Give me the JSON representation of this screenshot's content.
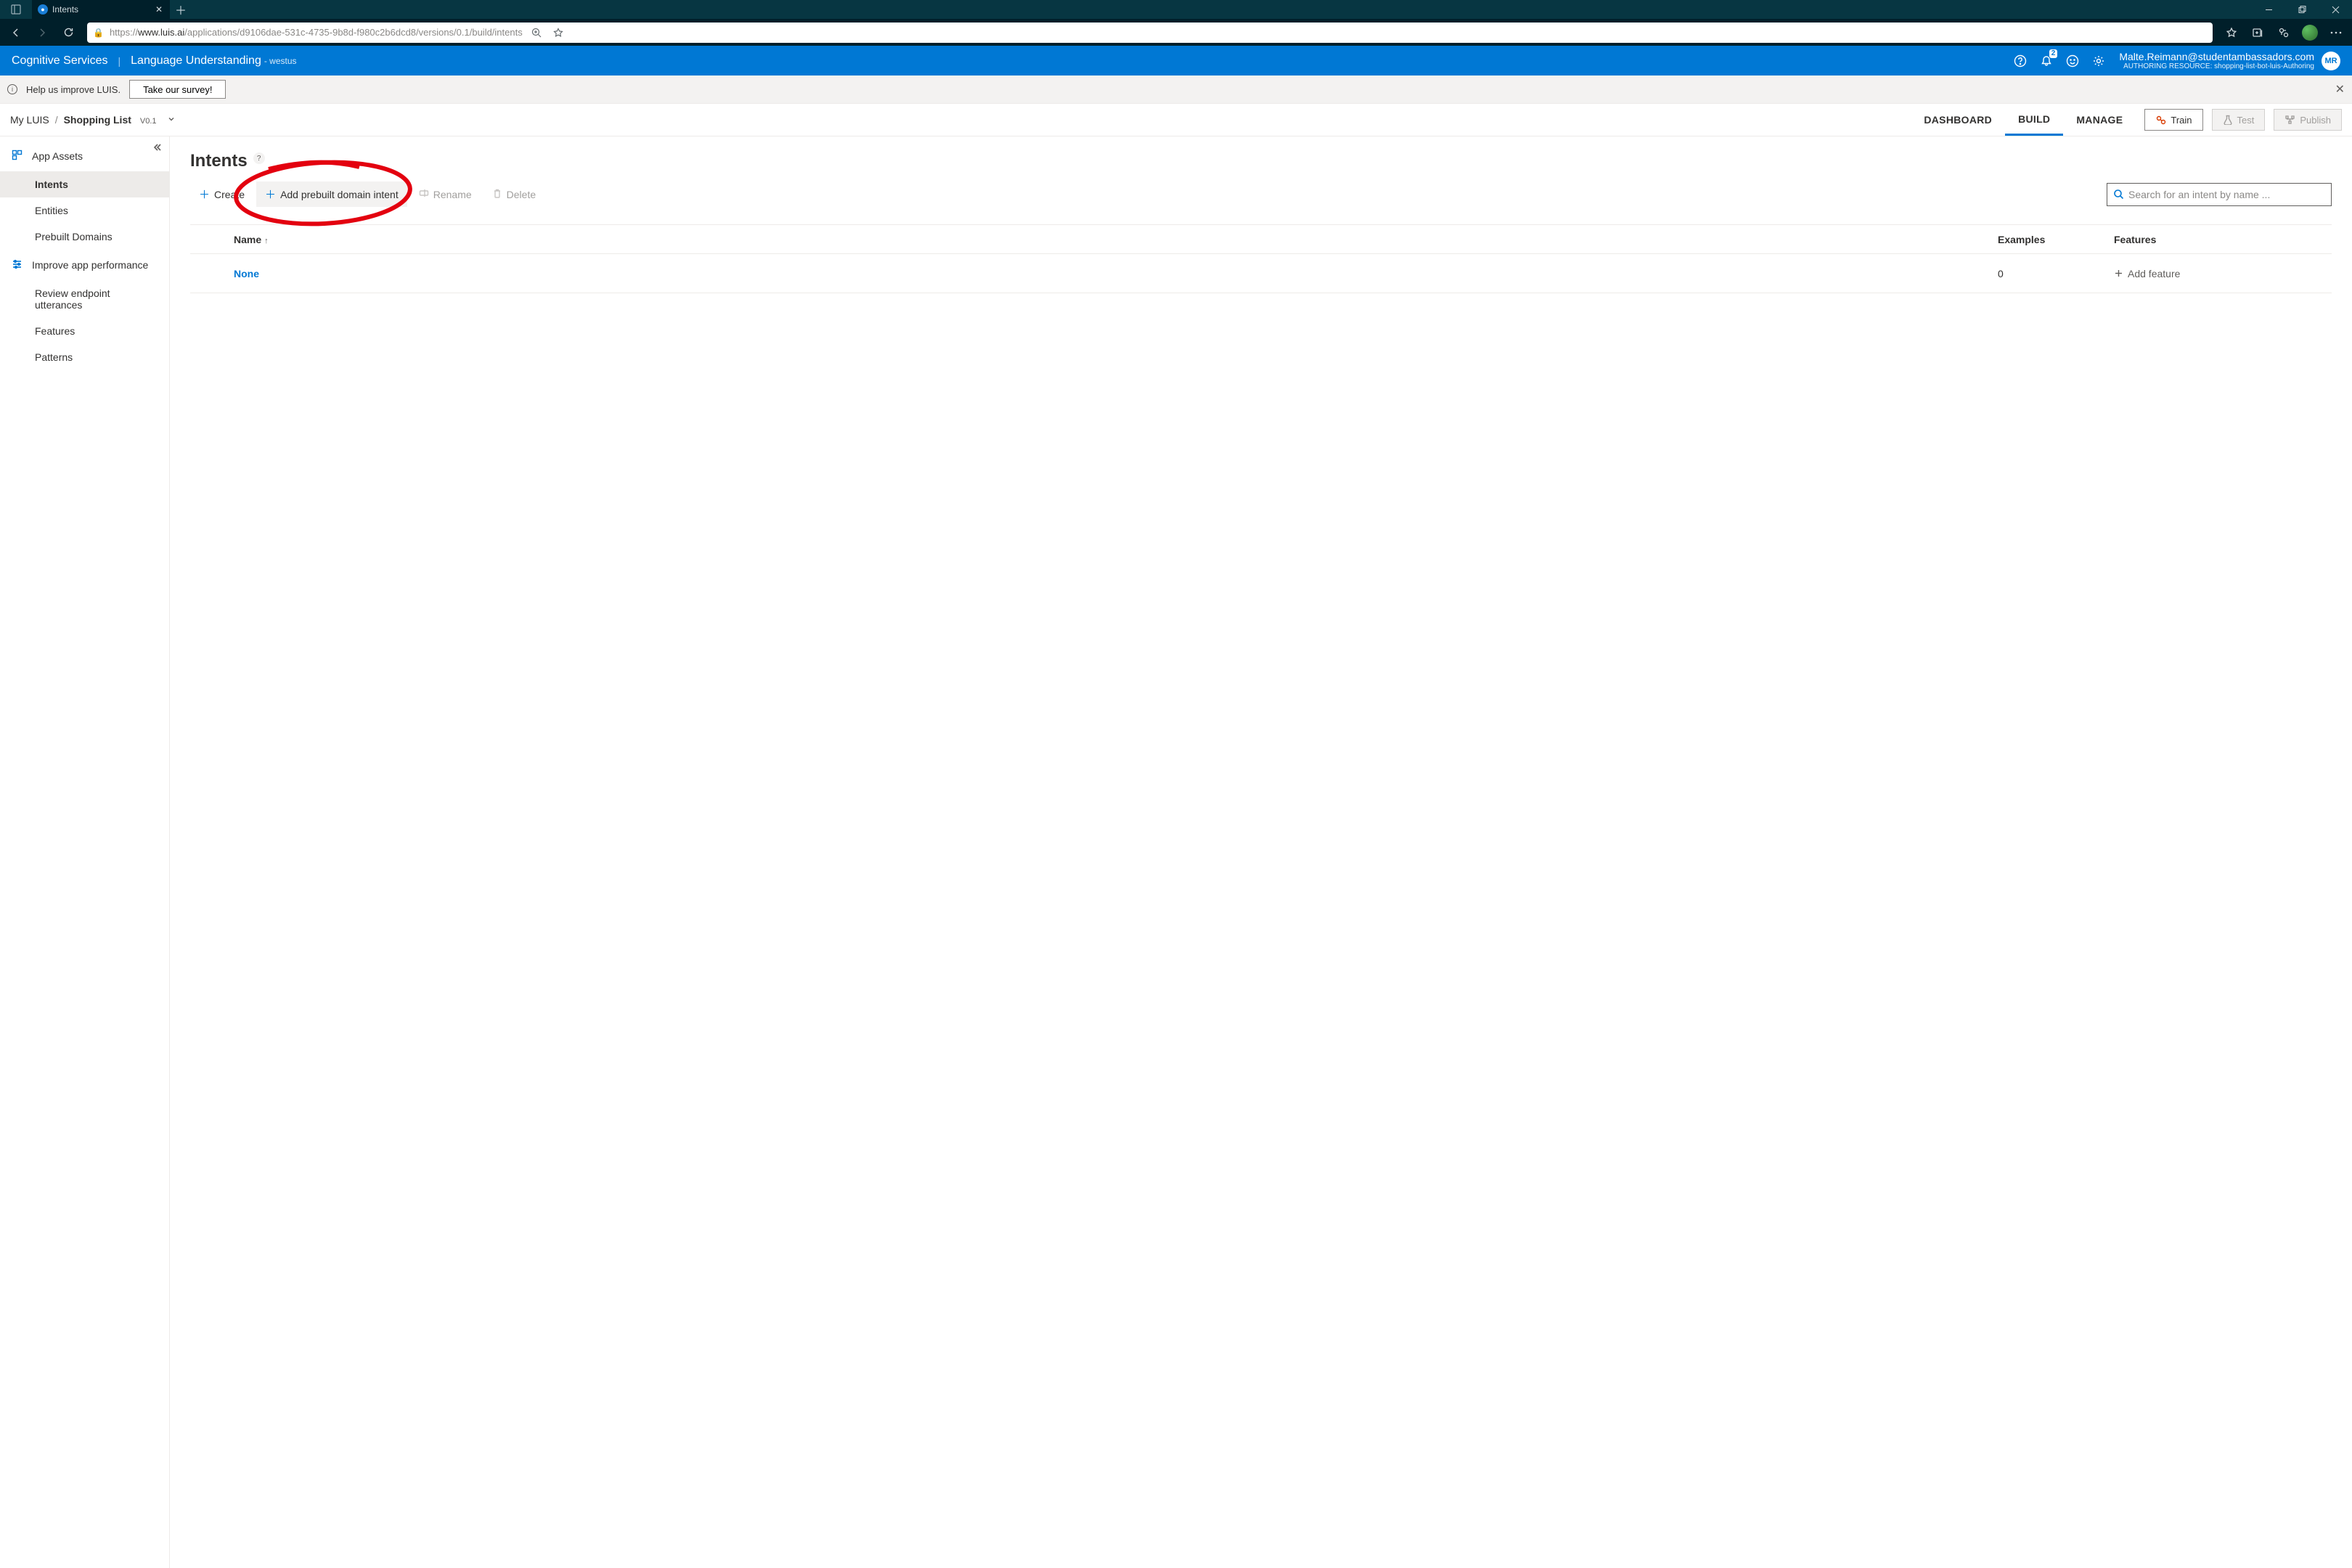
{
  "browser": {
    "tab_title": "Intents",
    "url_prefix": "https://",
    "url_host": "www.luis.ai",
    "url_path": "/applications/d9106dae-531c-4735-9b8d-f980c2b6dcd8/versions/0.1/build/intents"
  },
  "luis_header": {
    "service": "Cognitive Services",
    "product": "Language Understanding",
    "region": "- westus",
    "notification_count": "2",
    "user_email": "Malte.Reimann@studentambassadors.com",
    "resource_label": "AUTHORING RESOURCE:",
    "resource_name": "shopping-list-bot-luis-Authoring",
    "user_initials": "MR"
  },
  "banner": {
    "text": "Help us improve LUIS.",
    "button": "Take our survey!"
  },
  "breadcrumb": {
    "root": "My LUIS",
    "app": "Shopping List",
    "version": "V0.1"
  },
  "maintabs": {
    "dashboard": "DASHBOARD",
    "build": "BUILD",
    "manage": "MANAGE"
  },
  "actions": {
    "train": "Train",
    "test": "Test",
    "publish": "Publish"
  },
  "sidebar": {
    "group_assets": "App Assets",
    "intents": "Intents",
    "entities": "Entities",
    "prebuilt": "Prebuilt Domains",
    "group_improve": "Improve app performance",
    "review": "Review endpoint utterances",
    "features": "Features",
    "patterns": "Patterns"
  },
  "page": {
    "title": "Intents",
    "cmd_create": "Create",
    "cmd_add_prebuilt": "Add prebuilt domain intent",
    "cmd_rename": "Rename",
    "cmd_delete": "Delete",
    "search_placeholder": "Search for an intent by name ...",
    "col_name": "Name",
    "col_examples": "Examples",
    "col_features": "Features",
    "add_feature": "Add feature"
  },
  "rows": [
    {
      "name": "None",
      "examples": "0"
    }
  ]
}
